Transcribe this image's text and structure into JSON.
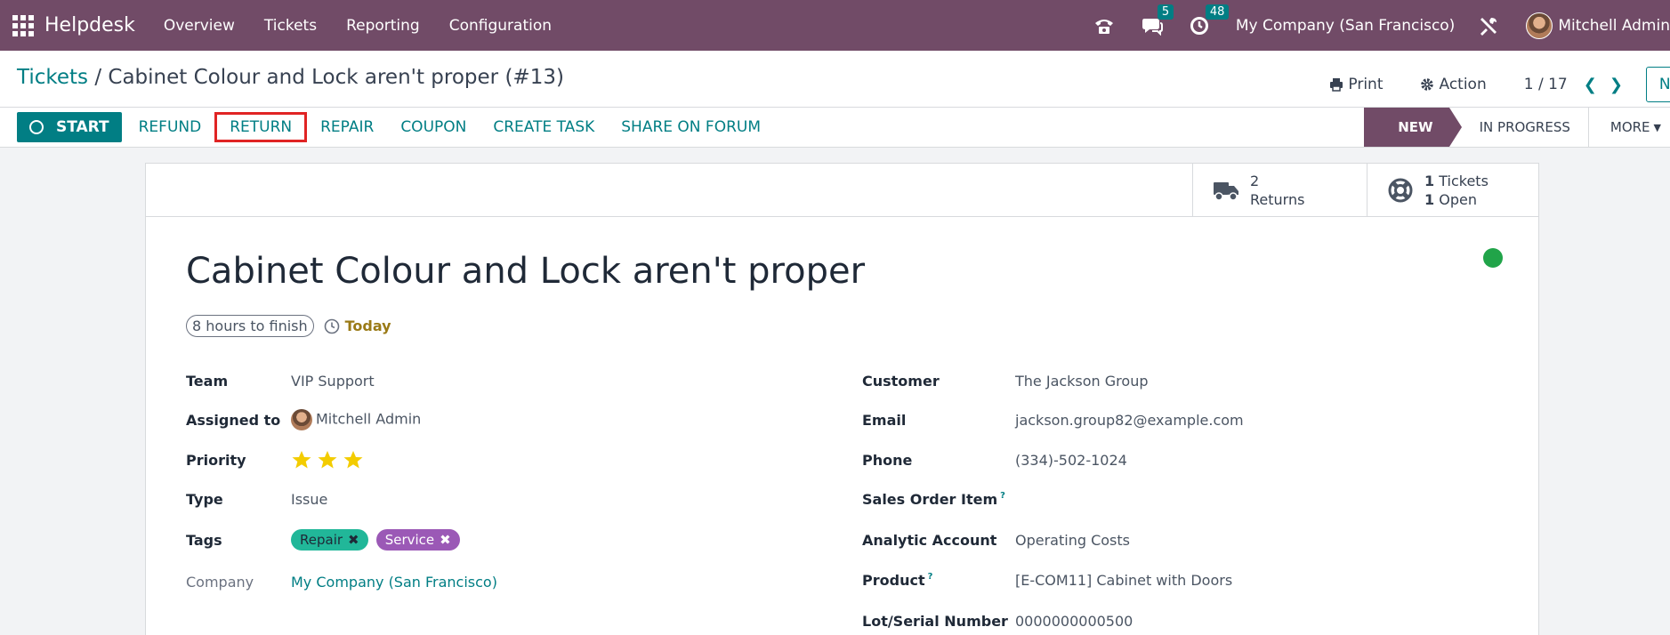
{
  "navbar": {
    "brand": "Helpdesk",
    "menu": [
      "Overview",
      "Tickets",
      "Reporting",
      "Configuration"
    ],
    "messages_count": "5",
    "activities_count": "48",
    "company": "My Company (San Francisco)",
    "user": "Mitchell Admin",
    "accent": "#714b67"
  },
  "control_panel": {
    "breadcrumb_parent": "Tickets",
    "breadcrumb_separator": "/",
    "breadcrumb_current": "Cabinet Colour and Lock aren't proper (#13)",
    "print_label": "Print",
    "action_label": "Action",
    "pager": "1 / 17",
    "new_label": "New"
  },
  "statusbar": {
    "start_label": "START",
    "buttons": [
      "REFUND",
      "RETURN",
      "REPAIR",
      "COUPON",
      "CREATE TASK",
      "SHARE ON FORUM"
    ],
    "highlighted": "RETURN",
    "stages": [
      "NEW",
      "IN PROGRESS",
      "MORE"
    ],
    "active_stage": "NEW"
  },
  "smart_buttons": {
    "returns": {
      "count": "2",
      "label": "Returns"
    },
    "tickets": {
      "count": "1",
      "label": "Tickets",
      "open_count": "1",
      "open_label": "Open"
    }
  },
  "ticket": {
    "title": "Cabinet Colour and Lock aren't proper",
    "sla": "8 hours to finish",
    "deadline": "Today",
    "status_color": "#21a449"
  },
  "fields_left": {
    "team": {
      "label": "Team",
      "value": "VIP Support"
    },
    "assigned": {
      "label": "Assigned to",
      "value": "Mitchell Admin"
    },
    "priority": {
      "label": "Priority",
      "stars": 3
    },
    "type": {
      "label": "Type",
      "value": "Issue"
    },
    "tags": {
      "label": "Tags",
      "items": [
        "Repair",
        "Service"
      ]
    },
    "company": {
      "label": "Company",
      "value": "My Company (San Francisco)"
    }
  },
  "fields_right": {
    "customer": {
      "label": "Customer",
      "value": "The Jackson Group"
    },
    "email": {
      "label": "Email",
      "value": "jackson.group82@example.com"
    },
    "phone": {
      "label": "Phone",
      "value": "(334)-502-1024"
    },
    "sales_order_item": {
      "label": "Sales Order Item",
      "help": "?"
    },
    "analytic_account": {
      "label": "Analytic Account",
      "value": "Operating Costs"
    },
    "product": {
      "label": "Product",
      "help": "?",
      "value": "[E-COM11] Cabinet with Doors"
    },
    "lot": {
      "label": "Lot/Serial Number",
      "value": "0000000000500"
    }
  }
}
